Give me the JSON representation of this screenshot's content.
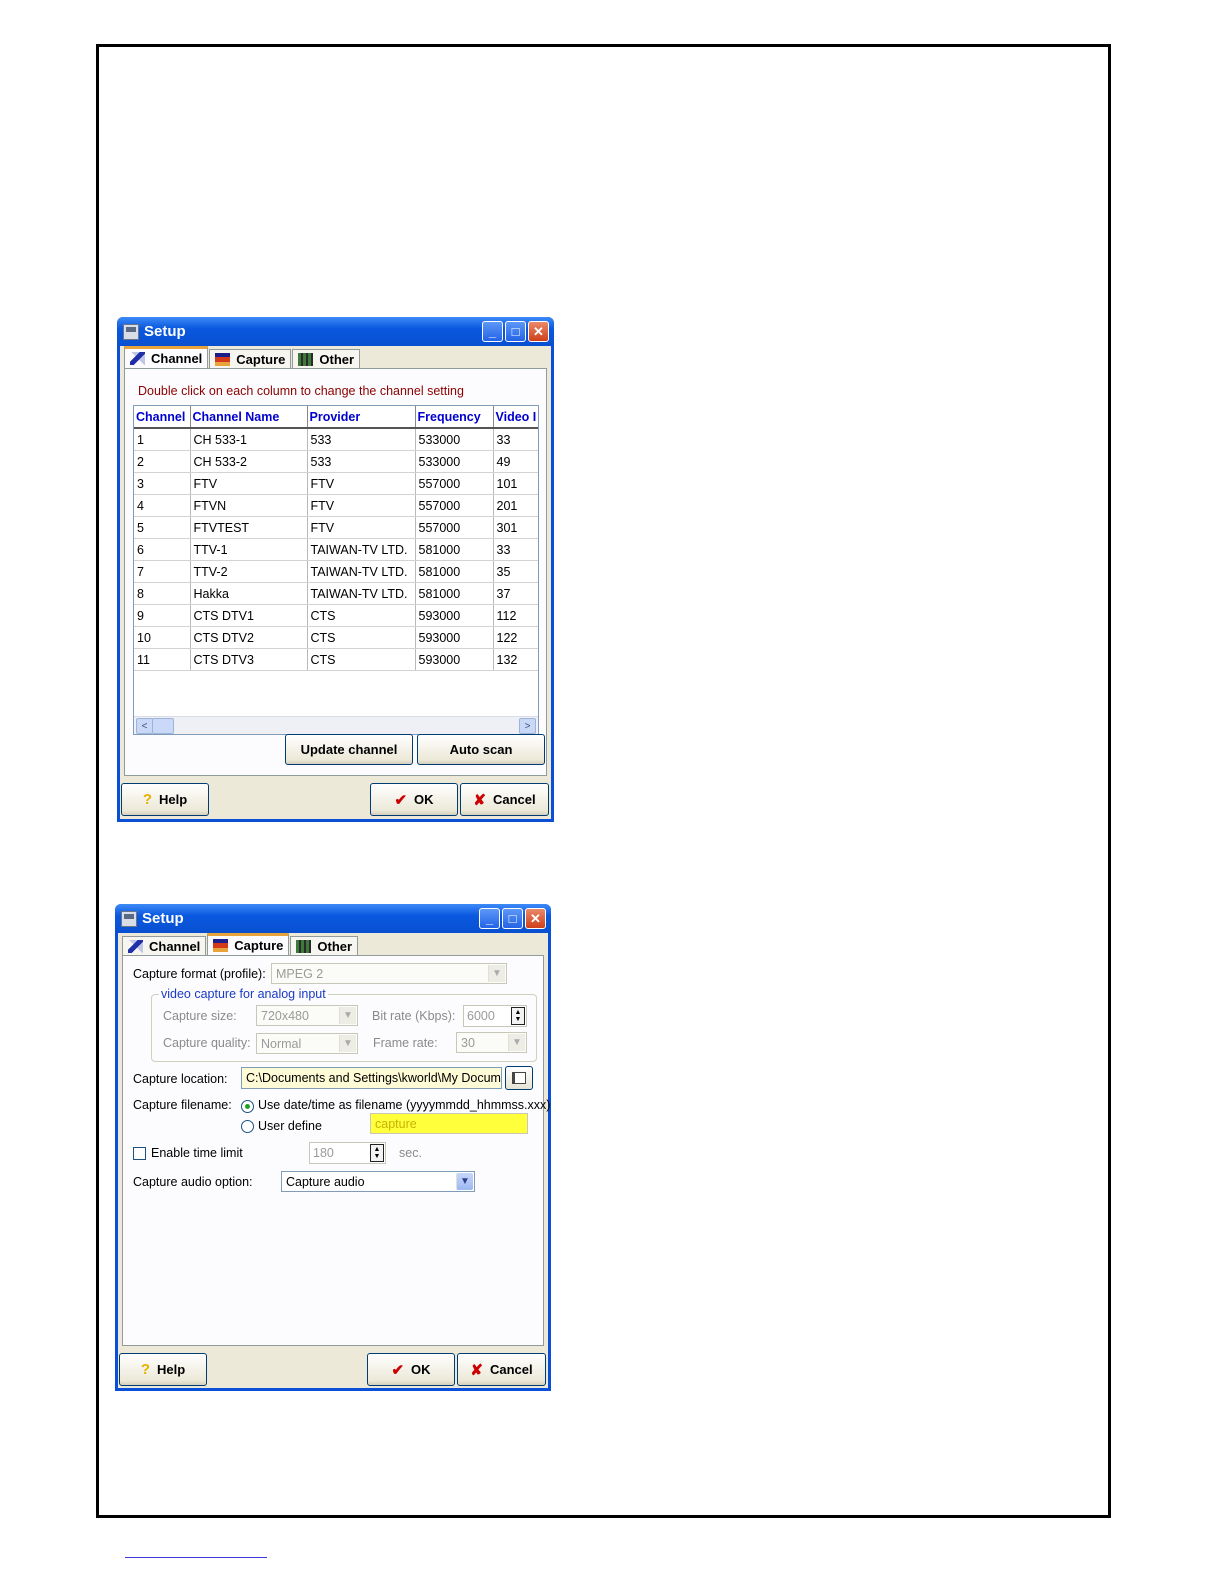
{
  "window1": {
    "title": "Setup",
    "tabs": [
      "Channel",
      "Capture",
      "Other"
    ],
    "active_tab": "Channel",
    "hint": "Double click on each column to change the channel setting",
    "columns": [
      "Channel",
      "Channel Name",
      "Provider",
      "Frequency",
      "Video I"
    ],
    "rows": [
      [
        "1",
        "CH 533-1",
        "533",
        "533000",
        "33"
      ],
      [
        "2",
        "CH 533-2",
        "533",
        "533000",
        "49"
      ],
      [
        "3",
        "FTV",
        "FTV",
        "557000",
        "101"
      ],
      [
        "4",
        "FTVN",
        "FTV",
        "557000",
        "201"
      ],
      [
        "5",
        "FTVTEST",
        "FTV",
        "557000",
        "301"
      ],
      [
        "6",
        "TTV-1",
        "TAIWAN-TV LTD.",
        "581000",
        "33"
      ],
      [
        "7",
        "TTV-2",
        "TAIWAN-TV LTD.",
        "581000",
        "35"
      ],
      [
        "8",
        "Hakka",
        "TAIWAN-TV LTD.",
        "581000",
        "37"
      ],
      [
        "9",
        "CTS DTV1",
        "CTS",
        "593000",
        "112"
      ],
      [
        "10",
        "CTS DTV2",
        "CTS",
        "593000",
        "122"
      ],
      [
        "11",
        "CTS DTV3",
        "CTS",
        "593000",
        "132"
      ]
    ],
    "update_channel": "Update channel",
    "auto_scan": "Auto scan",
    "help": "Help",
    "ok": "OK",
    "cancel": "Cancel"
  },
  "window2": {
    "title": "Setup",
    "tabs": [
      "Channel",
      "Capture",
      "Other"
    ],
    "active_tab": "Capture",
    "capture_format_label": "Capture format (profile):",
    "capture_format_value": "MPEG 2",
    "group_title": "video capture for analog input",
    "capture_size_label": "Capture size:",
    "capture_size_value": "720x480",
    "bit_rate_label": "Bit rate (Kbps):",
    "bit_rate_value": "6000",
    "capture_quality_label": "Capture quality:",
    "capture_quality_value": "Normal",
    "frame_rate_label": "Frame rate:",
    "frame_rate_value": "30",
    "capture_location_label": "Capture location:",
    "capture_location_value": "C:\\Documents and Settings\\kworld\\My Docum",
    "capture_filename_label": "Capture filename:",
    "radio_datetime_label": "Use date/time as filename (yyyymmdd_hhmmss.xxx)",
    "radio_user_label": "User define",
    "user_define_value": "capture",
    "enable_time_limit_label": "Enable time limit",
    "time_limit_value": "180",
    "time_limit_unit": "sec.",
    "audio_option_label": "Capture audio option:",
    "audio_option_value": "Capture audio",
    "help": "Help",
    "ok": "OK",
    "cancel": "Cancel"
  }
}
